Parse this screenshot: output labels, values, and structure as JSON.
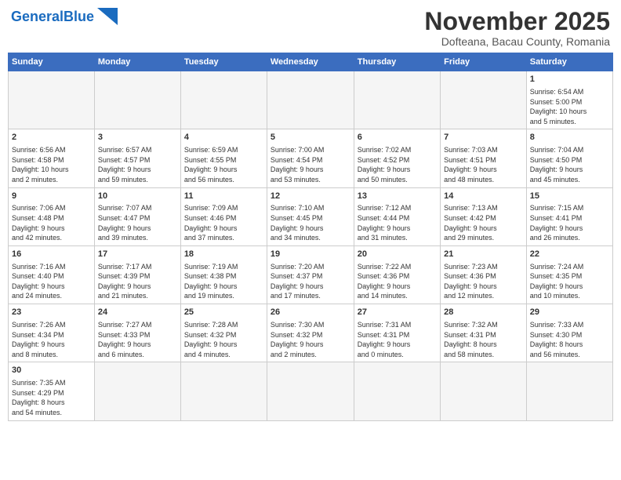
{
  "header": {
    "logo_general": "General",
    "logo_blue": "Blue",
    "month_title": "November 2025",
    "subtitle": "Dofteana, Bacau County, Romania"
  },
  "weekdays": [
    "Sunday",
    "Monday",
    "Tuesday",
    "Wednesday",
    "Thursday",
    "Friday",
    "Saturday"
  ],
  "weeks": [
    [
      {
        "day": null
      },
      {
        "day": null
      },
      {
        "day": null
      },
      {
        "day": null
      },
      {
        "day": null
      },
      {
        "day": null
      },
      {
        "day": "1",
        "info": "Sunrise: 6:54 AM\nSunset: 5:00 PM\nDaylight: 10 hours\nand 5 minutes."
      }
    ],
    [
      {
        "day": "2",
        "info": "Sunrise: 6:56 AM\nSunset: 4:58 PM\nDaylight: 10 hours\nand 2 minutes."
      },
      {
        "day": "3",
        "info": "Sunrise: 6:57 AM\nSunset: 4:57 PM\nDaylight: 9 hours\nand 59 minutes."
      },
      {
        "day": "4",
        "info": "Sunrise: 6:59 AM\nSunset: 4:55 PM\nDaylight: 9 hours\nand 56 minutes."
      },
      {
        "day": "5",
        "info": "Sunrise: 7:00 AM\nSunset: 4:54 PM\nDaylight: 9 hours\nand 53 minutes."
      },
      {
        "day": "6",
        "info": "Sunrise: 7:02 AM\nSunset: 4:52 PM\nDaylight: 9 hours\nand 50 minutes."
      },
      {
        "day": "7",
        "info": "Sunrise: 7:03 AM\nSunset: 4:51 PM\nDaylight: 9 hours\nand 48 minutes."
      },
      {
        "day": "8",
        "info": "Sunrise: 7:04 AM\nSunset: 4:50 PM\nDaylight: 9 hours\nand 45 minutes."
      }
    ],
    [
      {
        "day": "9",
        "info": "Sunrise: 7:06 AM\nSunset: 4:48 PM\nDaylight: 9 hours\nand 42 minutes."
      },
      {
        "day": "10",
        "info": "Sunrise: 7:07 AM\nSunset: 4:47 PM\nDaylight: 9 hours\nand 39 minutes."
      },
      {
        "day": "11",
        "info": "Sunrise: 7:09 AM\nSunset: 4:46 PM\nDaylight: 9 hours\nand 37 minutes."
      },
      {
        "day": "12",
        "info": "Sunrise: 7:10 AM\nSunset: 4:45 PM\nDaylight: 9 hours\nand 34 minutes."
      },
      {
        "day": "13",
        "info": "Sunrise: 7:12 AM\nSunset: 4:44 PM\nDaylight: 9 hours\nand 31 minutes."
      },
      {
        "day": "14",
        "info": "Sunrise: 7:13 AM\nSunset: 4:42 PM\nDaylight: 9 hours\nand 29 minutes."
      },
      {
        "day": "15",
        "info": "Sunrise: 7:15 AM\nSunset: 4:41 PM\nDaylight: 9 hours\nand 26 minutes."
      }
    ],
    [
      {
        "day": "16",
        "info": "Sunrise: 7:16 AM\nSunset: 4:40 PM\nDaylight: 9 hours\nand 24 minutes."
      },
      {
        "day": "17",
        "info": "Sunrise: 7:17 AM\nSunset: 4:39 PM\nDaylight: 9 hours\nand 21 minutes."
      },
      {
        "day": "18",
        "info": "Sunrise: 7:19 AM\nSunset: 4:38 PM\nDaylight: 9 hours\nand 19 minutes."
      },
      {
        "day": "19",
        "info": "Sunrise: 7:20 AM\nSunset: 4:37 PM\nDaylight: 9 hours\nand 17 minutes."
      },
      {
        "day": "20",
        "info": "Sunrise: 7:22 AM\nSunset: 4:36 PM\nDaylight: 9 hours\nand 14 minutes."
      },
      {
        "day": "21",
        "info": "Sunrise: 7:23 AM\nSunset: 4:36 PM\nDaylight: 9 hours\nand 12 minutes."
      },
      {
        "day": "22",
        "info": "Sunrise: 7:24 AM\nSunset: 4:35 PM\nDaylight: 9 hours\nand 10 minutes."
      }
    ],
    [
      {
        "day": "23",
        "info": "Sunrise: 7:26 AM\nSunset: 4:34 PM\nDaylight: 9 hours\nand 8 minutes."
      },
      {
        "day": "24",
        "info": "Sunrise: 7:27 AM\nSunset: 4:33 PM\nDaylight: 9 hours\nand 6 minutes."
      },
      {
        "day": "25",
        "info": "Sunrise: 7:28 AM\nSunset: 4:32 PM\nDaylight: 9 hours\nand 4 minutes."
      },
      {
        "day": "26",
        "info": "Sunrise: 7:30 AM\nSunset: 4:32 PM\nDaylight: 9 hours\nand 2 minutes."
      },
      {
        "day": "27",
        "info": "Sunrise: 7:31 AM\nSunset: 4:31 PM\nDaylight: 9 hours\nand 0 minutes."
      },
      {
        "day": "28",
        "info": "Sunrise: 7:32 AM\nSunset: 4:31 PM\nDaylight: 8 hours\nand 58 minutes."
      },
      {
        "day": "29",
        "info": "Sunrise: 7:33 AM\nSunset: 4:30 PM\nDaylight: 8 hours\nand 56 minutes."
      }
    ],
    [
      {
        "day": "30",
        "info": "Sunrise: 7:35 AM\nSunset: 4:29 PM\nDaylight: 8 hours\nand 54 minutes."
      },
      {
        "day": null
      },
      {
        "day": null
      },
      {
        "day": null
      },
      {
        "day": null
      },
      {
        "day": null
      },
      {
        "day": null
      }
    ]
  ]
}
